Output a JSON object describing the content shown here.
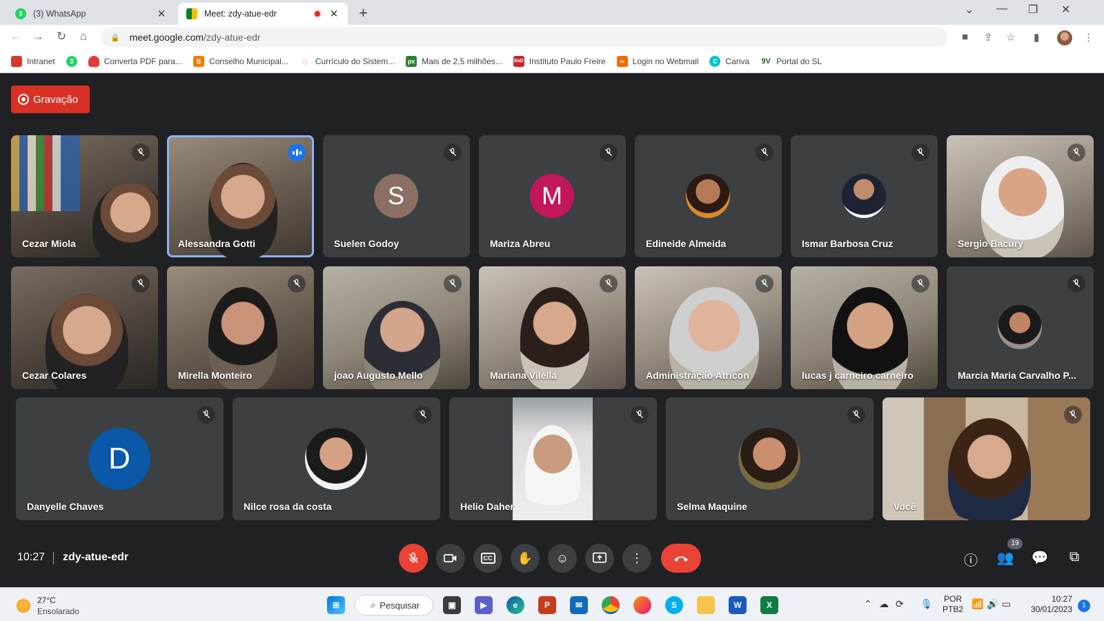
{
  "browser": {
    "tabs": [
      {
        "title": "(3) WhatsApp",
        "favicon": "whatsapp-icon",
        "badge": "3"
      },
      {
        "title": "Meet: zdy-atue-edr",
        "favicon": "google-meet-icon"
      }
    ],
    "url_host": "meet.google.com",
    "url_path": "/zdy-atue-edr",
    "bookmarks": [
      {
        "label": "Intranet",
        "color": "#d33b2c"
      },
      {
        "label": "",
        "color": "#25d366",
        "badge": "3"
      },
      {
        "label": "Converta PDF para...",
        "color": "#e53935"
      },
      {
        "label": "Conselho Municipal...",
        "color": "#f57c00"
      },
      {
        "label": "Currículo do Sistem...",
        "color": "#e53935"
      },
      {
        "label": "Mais de 2,5 milhões...",
        "color": "#2e7d32"
      },
      {
        "label": "Instituto Paulo Freire",
        "color": "#c62828"
      },
      {
        "label": "Login no Webmail",
        "color": "#ef6c00"
      },
      {
        "label": "Canva",
        "color": "#00c4cc"
      },
      {
        "label": "Portal do SL",
        "color": "#1b5e20"
      }
    ]
  },
  "meet": {
    "recording_label": "Gravação",
    "participants_row1": [
      {
        "name": "Cezar Miola",
        "type": "video"
      },
      {
        "name": "Alessandra Gotti",
        "type": "video",
        "speaking": true
      },
      {
        "name": "Suelen Godoy",
        "type": "letter",
        "letter": "S",
        "color": "#8d6e63"
      },
      {
        "name": "Mariza Abreu",
        "type": "letter",
        "letter": "M",
        "color": "#c2185b"
      },
      {
        "name": "Edineide Almeida",
        "type": "photo"
      },
      {
        "name": "Ismar Barbosa Cruz",
        "type": "photo"
      },
      {
        "name": "Sergio Bacury",
        "type": "video"
      }
    ],
    "participants_row2": [
      {
        "name": "Cezar Colares",
        "type": "video"
      },
      {
        "name": "Mirella Monteiro",
        "type": "video"
      },
      {
        "name": "joao Augusto Mello",
        "type": "video"
      },
      {
        "name": "Mariana Vilella",
        "type": "video"
      },
      {
        "name": "Administração Atricon",
        "type": "video"
      },
      {
        "name": "lucas j carneiro carneiro",
        "type": "video"
      },
      {
        "name": "Marcia Maria Carvalho P...",
        "type": "photo"
      }
    ],
    "participants_row3": [
      {
        "name": "Danyelle Chaves",
        "type": "letter",
        "letter": "D",
        "color": "#0b57a8"
      },
      {
        "name": "Nilce rosa da costa",
        "type": "photo"
      },
      {
        "name": "Helio Daher",
        "type": "video"
      },
      {
        "name": "Selma Maquine",
        "type": "photo"
      },
      {
        "name": "Você",
        "type": "video"
      }
    ],
    "time": "10:27",
    "meeting_code": "zdy-atue-edr",
    "participant_count": "19"
  },
  "taskbar": {
    "weather_temp": "27°C",
    "weather_desc": "Ensolarado",
    "search_label": "Pesquisar",
    "lang_line1": "POR",
    "lang_line2": "PTB2",
    "clock_time": "10:27",
    "clock_date": "30/01/2023",
    "notification_count": "1"
  }
}
